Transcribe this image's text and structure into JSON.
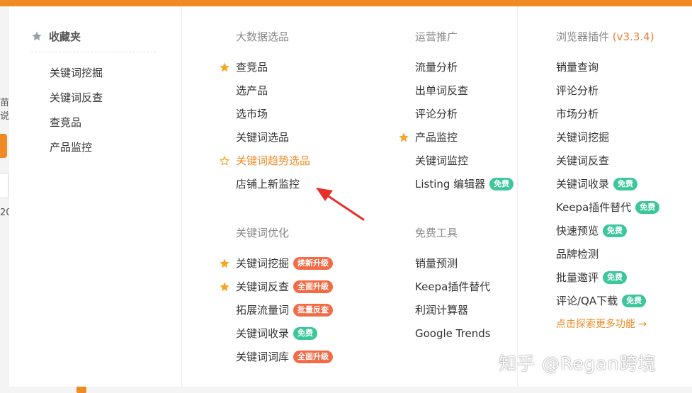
{
  "background": {
    "left_fragment_1": "苗说",
    "left_fragment_2": "20"
  },
  "favorites": {
    "title": "收藏夹",
    "items": [
      "关键词挖掘",
      "关键词反查",
      "查竞品",
      "产品监控"
    ]
  },
  "big_data": {
    "title": "大数据选品",
    "items": [
      {
        "label": "查竞品",
        "star": "filled"
      },
      {
        "label": "选产品"
      },
      {
        "label": "选市场"
      },
      {
        "label": "关键词选品"
      },
      {
        "label": "关键词趋势选品",
        "star": "outline"
      },
      {
        "label": "店铺上新监控"
      }
    ]
  },
  "keyword_opt": {
    "title": "关键词优化",
    "items": [
      {
        "label": "关键词挖掘",
        "star": "filled",
        "badge": "焕新升级"
      },
      {
        "label": "关键词反查",
        "star": "filled",
        "badge": "全面升级"
      },
      {
        "label": "拓展流量词",
        "badge": "批量反查"
      },
      {
        "label": "关键词收录",
        "badge": "免费"
      },
      {
        "label": "关键词词库",
        "badge": "全面升级"
      }
    ]
  },
  "ops": {
    "title": "运营推广",
    "items": [
      {
        "label": "流量分析"
      },
      {
        "label": "出单词反查"
      },
      {
        "label": "评论分析"
      },
      {
        "label": "产品监控",
        "star": "filled"
      },
      {
        "label": "关键词监控"
      },
      {
        "label": "Listing 编辑器",
        "badge": "免费"
      }
    ]
  },
  "free_tools": {
    "title": "免费工具",
    "items": [
      {
        "label": "销量预测"
      },
      {
        "label": "Keepa插件替代"
      },
      {
        "label": "利润计算器"
      },
      {
        "label": "Google Trends"
      }
    ]
  },
  "plugin": {
    "title": "浏览器插件",
    "version": "(v3.3.4)",
    "items": [
      {
        "label": "销量查询"
      },
      {
        "label": "评论分析"
      },
      {
        "label": "市场分析"
      },
      {
        "label": "关键词挖掘"
      },
      {
        "label": "关键词反查"
      },
      {
        "label": "关键词收录",
        "badge": "免费"
      },
      {
        "label": "Keepa插件替代",
        "badge": "免费"
      },
      {
        "label": "快速预览",
        "badge": "免费"
      },
      {
        "label": "品牌检测"
      },
      {
        "label": "批量邀评",
        "badge": "免费"
      },
      {
        "label": "评论/QA下载",
        "badge": "免费"
      }
    ],
    "more": "点击探索更多功能 →"
  },
  "watermark": "知乎 @Regan跨境",
  "colors": {
    "accent": "#f08a24",
    "badge_orange": "#f26b46",
    "badge_green": "#3cc79a",
    "star": "#f5a623",
    "arrow": "#e8302a",
    "section_title": "#888888"
  }
}
